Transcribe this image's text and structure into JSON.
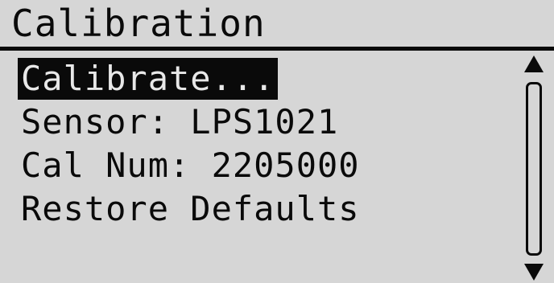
{
  "header": {
    "title": "Calibration"
  },
  "menu": {
    "items": [
      {
        "label": "Calibrate..."
      },
      {
        "label": "Sensor: LPS1021"
      },
      {
        "label": "Cal Num: 2205000"
      },
      {
        "label": "Restore Defaults"
      }
    ],
    "selected_index": 0
  },
  "scrollbar": {
    "up_icon": "arrow-up-icon",
    "down_icon": "arrow-down-icon"
  },
  "colors": {
    "background": "#d6d6d6",
    "foreground": "#0a0a0a",
    "highlight_text": "#e8e8e8"
  }
}
